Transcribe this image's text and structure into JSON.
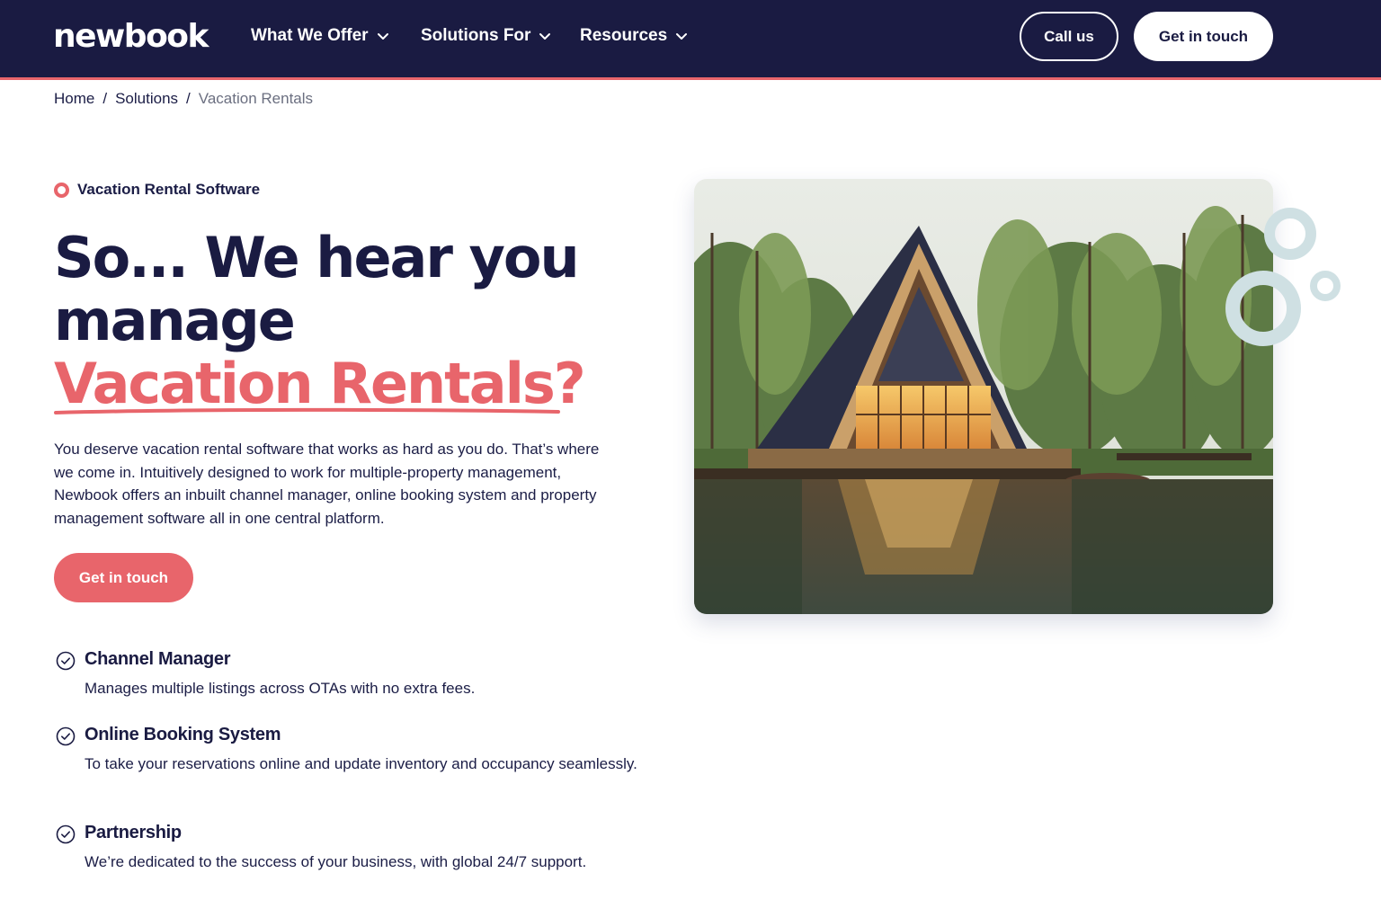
{
  "header": {
    "logo_text": "newbook",
    "nav": [
      {
        "label": "What We Offer"
      },
      {
        "label": "Solutions For"
      },
      {
        "label": "Resources"
      }
    ],
    "call_label": "Call us",
    "touch_label": "Get in touch"
  },
  "breadcrumb": {
    "items": [
      "Home",
      "Solutions",
      "Vacation Rentals"
    ],
    "separator": "/"
  },
  "hero": {
    "eyebrow": "Vacation Rental Software",
    "headline_line1": "So... We hear you",
    "headline_line2": "manage",
    "headline_accent": "Vacation Rentals?",
    "intro": "You deserve vacation rental software that works as hard as you do. That’s where we come in. Intuitively designed to work for multiple-property management, Newbook offers an inbuilt channel manager, online booking system and property management software all in one central platform.",
    "cta_label": "Get in touch"
  },
  "features": [
    {
      "title": "Channel Manager",
      "description": "Manages multiple listings across OTAs with no extra fees."
    },
    {
      "title": "Online Booking System",
      "description": "To take your reservations online and update inventory and occupancy seamlessly."
    },
    {
      "title": "Partnership",
      "description": "We’re dedicated to the success of your business, with global 24/7 support."
    }
  ],
  "icons": {
    "nav_chevron": "chevron-down-icon",
    "feature_check": "check-circle-icon",
    "eyebrow": "ring-dot-icon"
  },
  "colors": {
    "navy": "#1a1b42",
    "coral": "#e8656b",
    "deco": "#cfe0e3"
  }
}
